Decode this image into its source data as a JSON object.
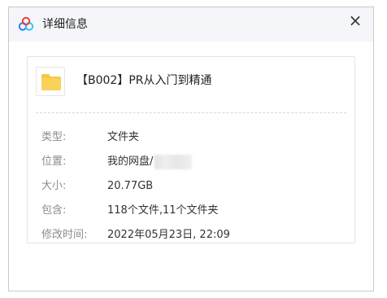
{
  "window": {
    "title": "详细信息",
    "close_glyph": "×",
    "app_icon": "baidu-netdisk-icon"
  },
  "file": {
    "name": "【B002】PR从入门到精通",
    "icon": "folder-icon",
    "icon_color": "#F7C843"
  },
  "details": [
    {
      "label": "类型:",
      "value": "文件夹"
    },
    {
      "label": "位置:",
      "value": "我的网盘/"
    },
    {
      "label": "大小:",
      "value": "20.77GB"
    },
    {
      "label": "包含:",
      "value": "118个文件,11个文件夹"
    },
    {
      "label": "修改时间:",
      "value": "2022年05月23日, 22:09"
    }
  ]
}
